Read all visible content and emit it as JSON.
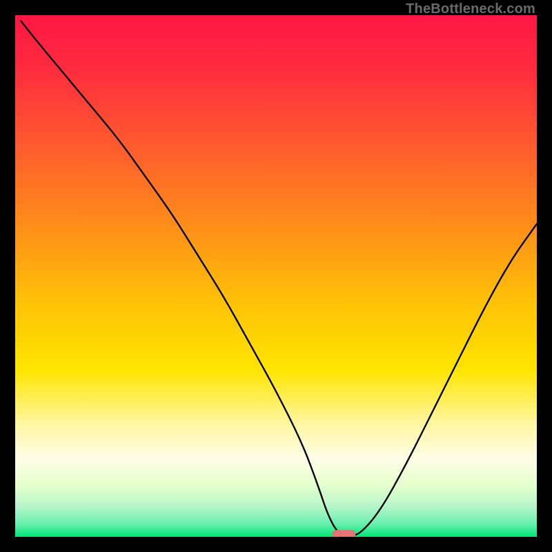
{
  "watermark": "TheBottleneck.com",
  "chart_data": {
    "type": "line",
    "title": "",
    "xlabel": "",
    "ylabel": "",
    "xlim": [
      0,
      100
    ],
    "ylim": [
      0,
      100
    ],
    "grid": false,
    "legend": false,
    "gradient_stops": [
      {
        "offset": 0.0,
        "color": "#ff1744"
      },
      {
        "offset": 0.1,
        "color": "#ff2b3f"
      },
      {
        "offset": 0.25,
        "color": "#ff5a2e"
      },
      {
        "offset": 0.4,
        "color": "#ff8c1a"
      },
      {
        "offset": 0.55,
        "color": "#ffc107"
      },
      {
        "offset": 0.68,
        "color": "#ffe500"
      },
      {
        "offset": 0.78,
        "color": "#fff59d"
      },
      {
        "offset": 0.85,
        "color": "#fffde7"
      },
      {
        "offset": 0.9,
        "color": "#e6ffcc"
      },
      {
        "offset": 0.94,
        "color": "#b9f6ca"
      },
      {
        "offset": 0.975,
        "color": "#69f0ae"
      },
      {
        "offset": 1.0,
        "color": "#00e676"
      }
    ],
    "series": [
      {
        "name": "bottleneck-curve",
        "x": [
          1,
          5,
          10,
          15,
          20,
          25,
          30,
          35,
          40,
          45,
          50,
          55,
          58,
          60,
          62,
          64,
          66,
          70,
          75,
          80,
          85,
          90,
          95,
          100
        ],
        "y": [
          99,
          94,
          88,
          82,
          76,
          69,
          62,
          54,
          46,
          37,
          28,
          18,
          10,
          4,
          0.5,
          0.3,
          0.4,
          5,
          14,
          24,
          34,
          44,
          53,
          60
        ]
      }
    ],
    "marker": {
      "name": "optimal-marker",
      "x": 63,
      "y": 0.5,
      "width": 4.5,
      "height": 1.6,
      "color": "#e57373"
    }
  }
}
